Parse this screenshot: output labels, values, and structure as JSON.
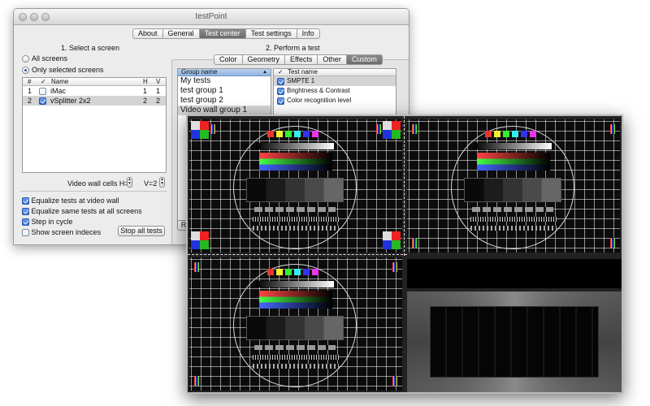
{
  "window": {
    "title": "testPoint"
  },
  "top_tabs": [
    {
      "label": "About",
      "active": false
    },
    {
      "label": "General",
      "active": false
    },
    {
      "label": "Test center",
      "active": true
    },
    {
      "label": "Test settings",
      "active": false
    },
    {
      "label": "Info",
      "active": false
    }
  ],
  "left": {
    "section_title": "1. Select a screen",
    "radio_all": "All screens",
    "radio_selected": "Only selected screens",
    "selected_radio": "Only selected screens",
    "table": {
      "headers": {
        "num": "#",
        "check": "✓",
        "name": "Name",
        "h": "H",
        "v": "V"
      },
      "rows": [
        {
          "num": "1",
          "checked": false,
          "name": "iMac",
          "h": "1",
          "v": "1"
        },
        {
          "num": "2",
          "checked": true,
          "name": "vSplitter 2x2",
          "h": "2",
          "v": "2"
        }
      ]
    },
    "video_wall_cells_label": "Video wall cells H=2",
    "v_label": "V=2",
    "options": [
      {
        "label": "Equalize tests at video wall",
        "checked": true
      },
      {
        "label": "Equalize same tests at all screens",
        "checked": true
      },
      {
        "label": "Step in cycle",
        "checked": true
      },
      {
        "label": "Show screen indeces",
        "checked": false
      }
    ],
    "stop_button": "Stop all tests"
  },
  "right": {
    "section_title": "2. Perform a test",
    "tabs": [
      {
        "label": "Color",
        "active": false
      },
      {
        "label": "Geometry",
        "active": false
      },
      {
        "label": "Effects",
        "active": false
      },
      {
        "label": "Other",
        "active": false
      },
      {
        "label": "Custom",
        "active": true
      }
    ],
    "groups": {
      "header": "Group name",
      "items": [
        "My tests",
        "test group 1",
        "test group 2",
        "Video wall group 1"
      ],
      "selected": "Video wall group 1"
    },
    "tests": {
      "header_check": "✓",
      "header_name": "Test name",
      "items": [
        {
          "label": "SMPTE 1",
          "checked": true
        },
        {
          "label": "Brightness & Contrast",
          "checked": true
        },
        {
          "label": "Color recognition level",
          "checked": true
        }
      ]
    },
    "partial_button": "R"
  },
  "colors": {
    "active_tab": "#7a7a7a",
    "selection": "#d4d4d4",
    "checkbox_blue": "#2e6bd0",
    "list_header": "#a6c3e8"
  }
}
